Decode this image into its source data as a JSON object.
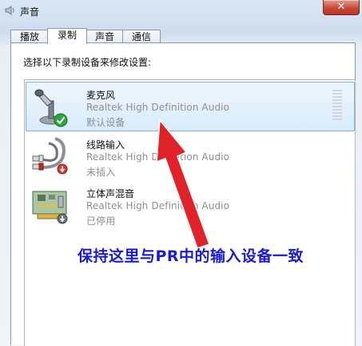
{
  "window": {
    "title": "声音",
    "close_glyph": "✕"
  },
  "tabs": [
    {
      "label": "播放",
      "active": false
    },
    {
      "label": "录制",
      "active": true
    },
    {
      "label": "声音",
      "active": false
    },
    {
      "label": "通信",
      "active": false
    }
  ],
  "instructions": "选择以下录制设备来修改设置:",
  "devices": [
    {
      "name": "麦克风",
      "driver": "Realtek High Definition Audio",
      "status": "默认设备",
      "icon": "microphone-icon",
      "badge": "default-check-icon",
      "selected": true
    },
    {
      "name": "线路输入",
      "driver": "Realtek High Definition Audio",
      "status": "未插入",
      "icon": "line-in-cable-icon",
      "badge": "unplugged-down-arrow-icon",
      "selected": false
    },
    {
      "name": "立体声混音",
      "driver": "Realtek High Definition Audio",
      "status": "已停用",
      "icon": "sound-card-icon",
      "badge": "disabled-down-arrow-icon",
      "selected": false
    }
  ],
  "annotation": {
    "text": "保持这里与PR中的输入设备一致",
    "text_color": "#1a1ad8",
    "arrow_color": "#e0222a"
  }
}
